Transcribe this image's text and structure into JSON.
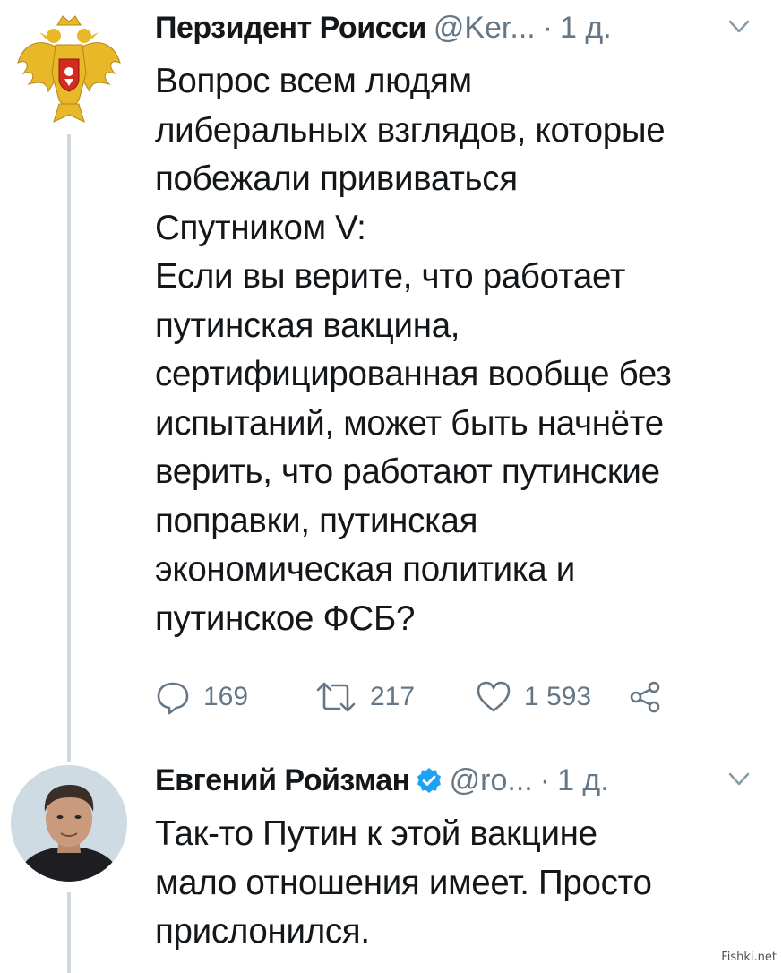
{
  "tweets": [
    {
      "author_name": "Перзидент Роисси",
      "handle": "@Ker...",
      "time": "1 д.",
      "separator": "·",
      "avatar_icon": "double-headed-eagle-coat-of-arms",
      "body_lines": [
        "Вопрос всем людям",
        "либеральных взглядов, которые",
        "побежали прививаться",
        "Спутником V:",
        "Если вы верите, что работает",
        "путинская вакцина,",
        "сертифицированная вообще без",
        "испытаний, может быть начнёте",
        "верить, что работают путинские",
        "поправки, путинская",
        "экономическая политика и",
        "путинское ФСБ?"
      ],
      "actions": {
        "replies": "169",
        "retweets": "217",
        "likes": "1 593"
      }
    },
    {
      "author_name": "Евгений Ройзман",
      "verified": true,
      "handle": "@ro...",
      "time": "1 д.",
      "separator": "·",
      "avatar_icon": "man-portrait-photo",
      "body_lines": [
        "Так-то Путин к этой вакцине",
        "мало отношения имеет. Просто",
        "прислонился."
      ]
    }
  ],
  "watermark": "Fishki.net",
  "colors": {
    "text": "#14171a",
    "secondary": "#657786",
    "verified_blue": "#1da1f2",
    "thread_line": "#cfd9de",
    "eagle_gold": "#e8b828",
    "shield_red": "#d52b1e"
  }
}
